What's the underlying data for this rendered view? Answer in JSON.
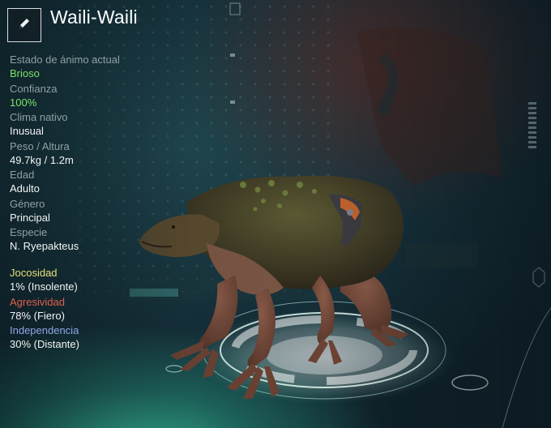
{
  "header": {
    "title": "Waili-Waili",
    "edit_icon": "pencil-icon"
  },
  "stats": [
    {
      "label": "Estado de ánimo actual",
      "value": "Brioso",
      "highlight": true
    },
    {
      "label": "Confianza",
      "value": "100%",
      "highlight": true
    },
    {
      "label": "Clima nativo",
      "value": "Inusual",
      "highlight": false
    },
    {
      "label": "Peso / Altura",
      "value": "49.7kg / 1.2m",
      "highlight": false
    },
    {
      "label": "Edad",
      "value": "Adulto",
      "highlight": false
    },
    {
      "label": "Género",
      "value": "Principal",
      "highlight": false
    },
    {
      "label": "Especie",
      "value": "N. Ryepakteus",
      "highlight": false
    }
  ],
  "traits": [
    {
      "label": "Jocosidad",
      "value": "1% (Insolente)",
      "color": "#e3e07a"
    },
    {
      "label": "Agresividad",
      "value": "78% (Fiero)",
      "color": "#e0604c"
    },
    {
      "label": "Independencia",
      "value": "30% (Distante)",
      "color": "#8fa8e8"
    }
  ],
  "colors": {
    "positive": "#7be36a",
    "text": "#f2f4f4",
    "label": "#8fa0a6"
  }
}
